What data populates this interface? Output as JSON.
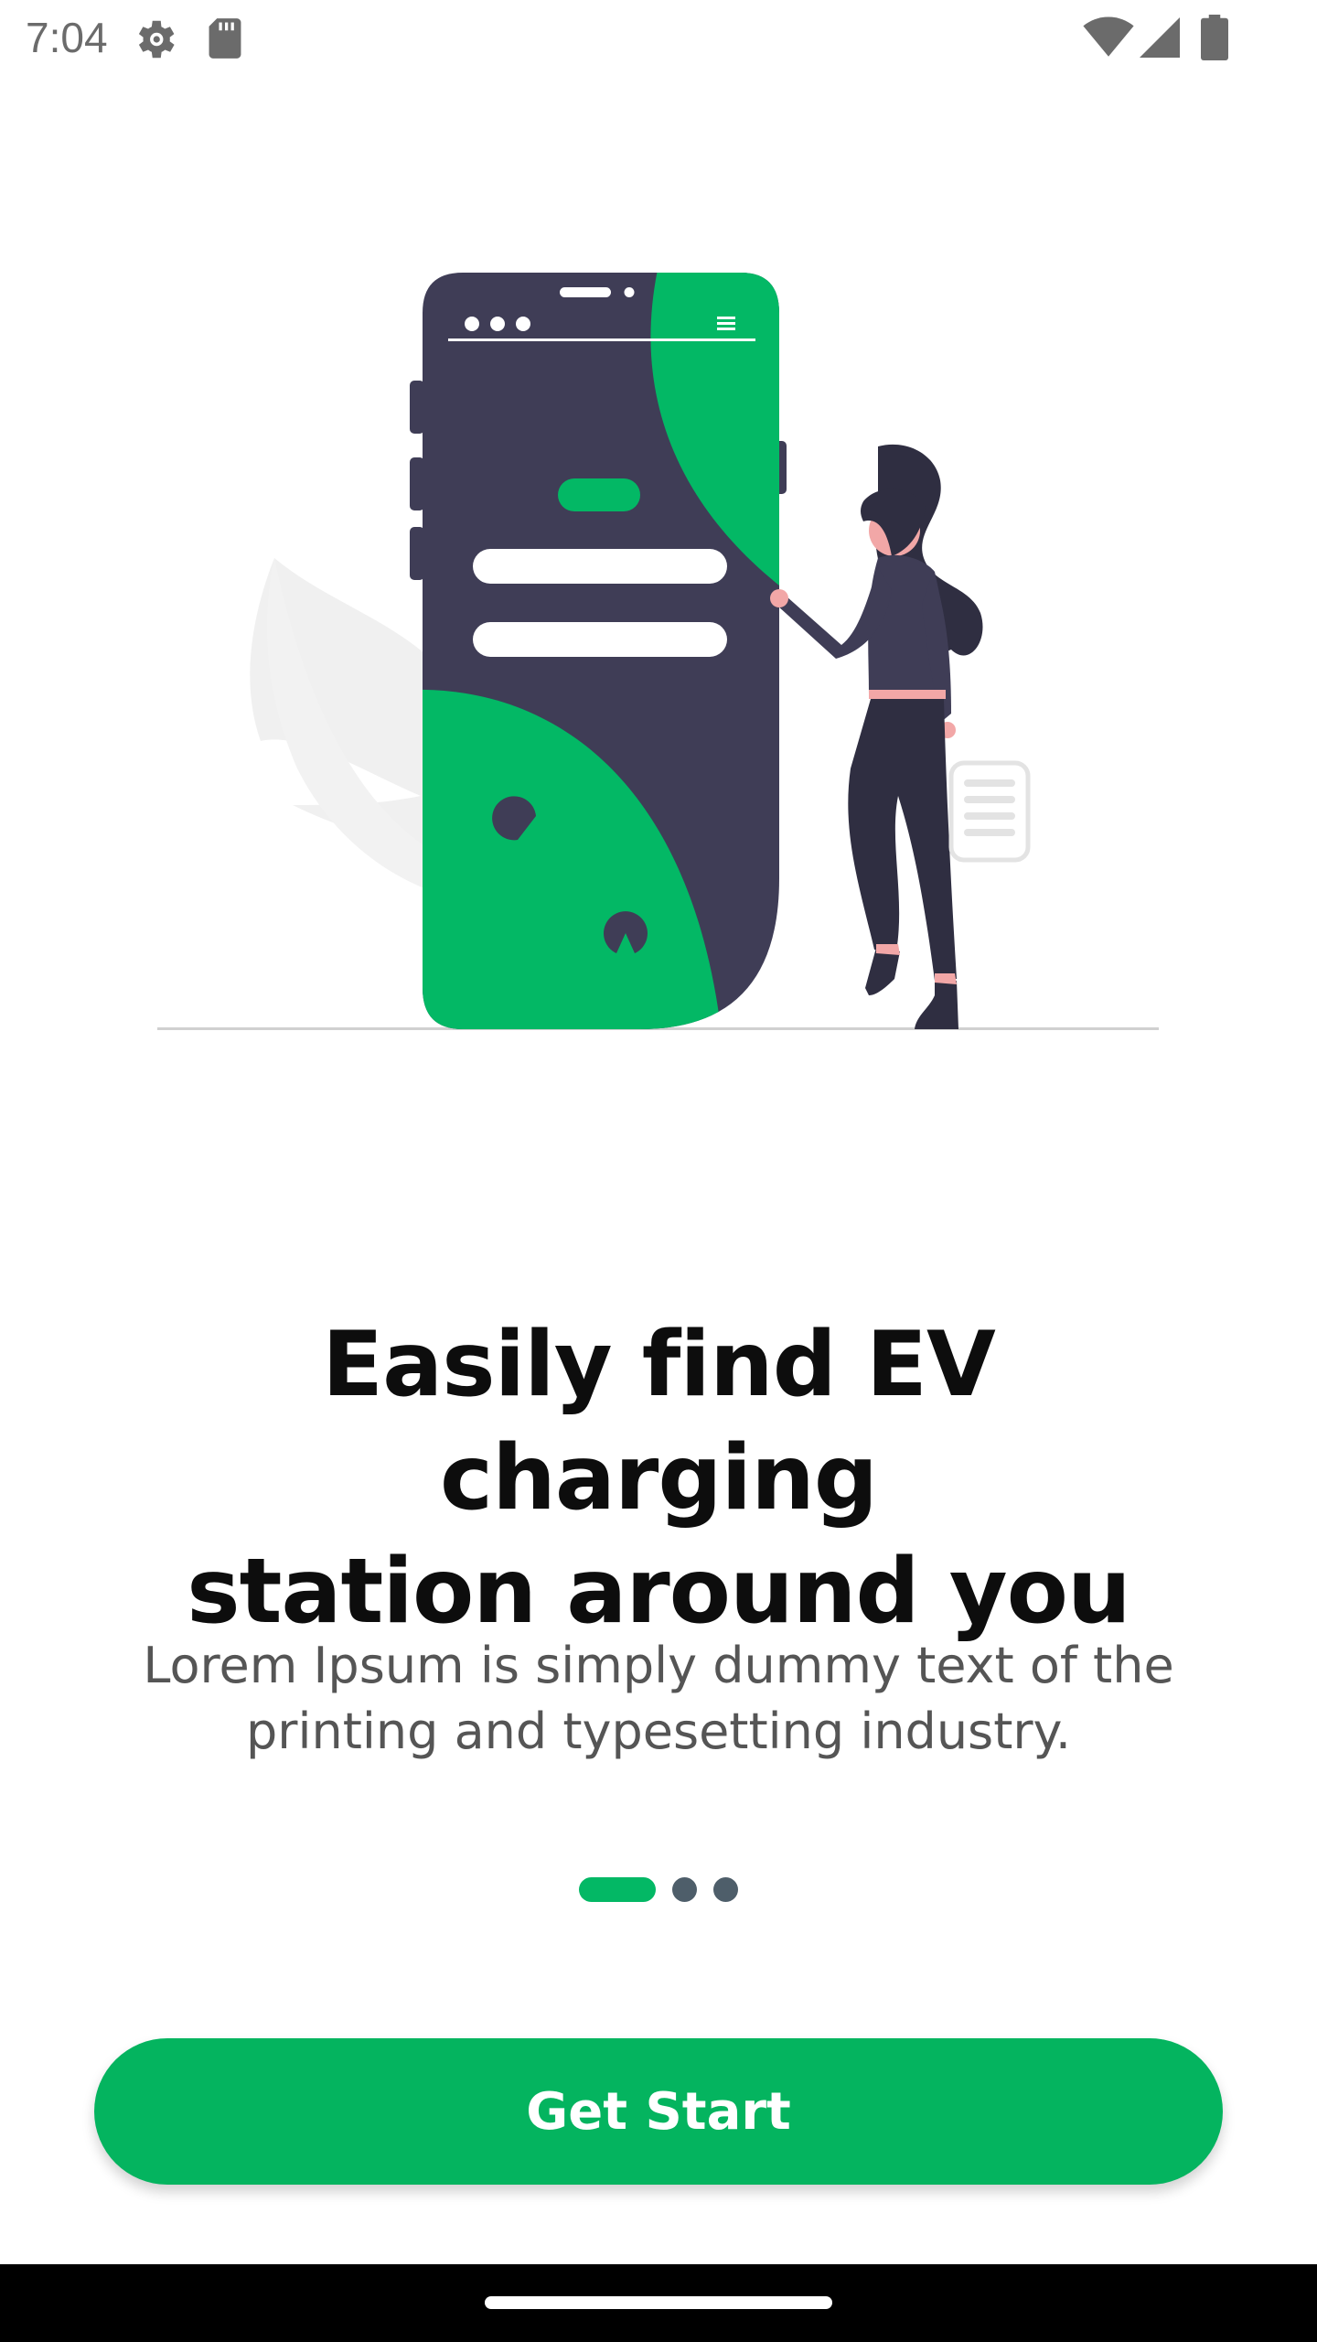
{
  "status_bar": {
    "time": "7:04",
    "icons": [
      "settings-gear-icon",
      "sd-card-icon",
      "wifi-icon",
      "cellular-signal-icon",
      "battery-icon"
    ]
  },
  "illustration": {
    "name": "woman-with-phone-illustration",
    "accent_color": "#03b865",
    "dark_color": "#3f3d56"
  },
  "onboarding": {
    "title": "Easily find EV charging\nstation around you",
    "subtitle": "Lorem Ipsum is simply dummy text of the printing and typesetting industry.",
    "page_indicator": {
      "current_page": 1,
      "total_pages": 3
    },
    "cta_label": "Get Start"
  },
  "colors": {
    "primary": "#04b45f",
    "indicator_inactive": "#4e5e6a",
    "title_text": "#0d0d0d",
    "subtitle_text": "#555555"
  }
}
